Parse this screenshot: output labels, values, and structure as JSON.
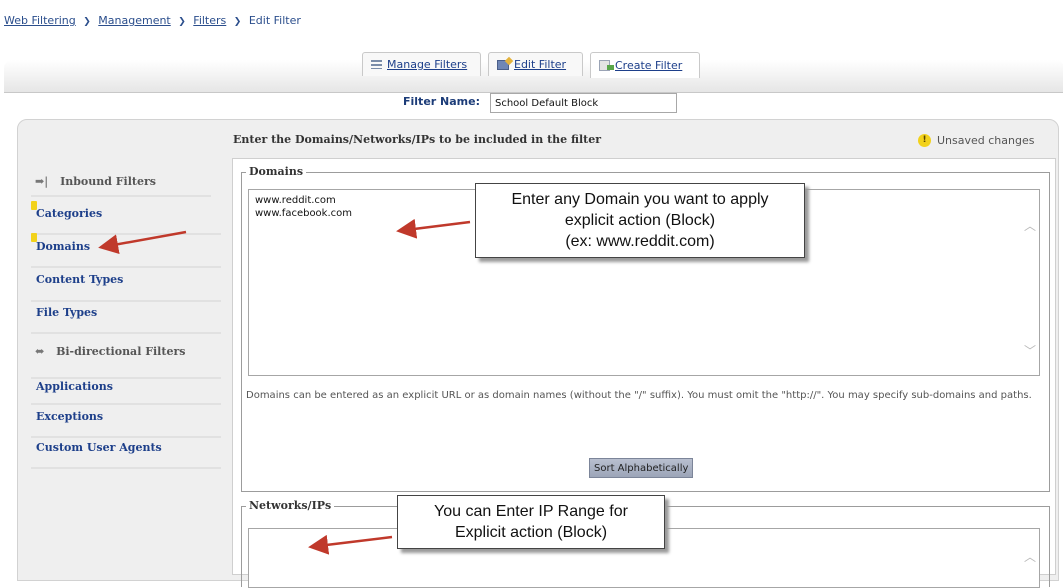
{
  "breadcrumb": {
    "items": [
      "Web Filtering",
      "Management",
      "Filters"
    ],
    "current": "Edit Filter",
    "separator": "❯"
  },
  "tabs": [
    {
      "label": "Manage Filters",
      "icon": "list-icon"
    },
    {
      "label": "Edit Filter",
      "icon": "edit-icon"
    },
    {
      "label": "Create Filter",
      "icon": "create-icon"
    }
  ],
  "filter_name": {
    "label": "Filter Name:",
    "value": "School Default Block"
  },
  "panel": {
    "instructions": "Enter the Domains/Networks/IPs to be included in the filter",
    "status": "Unsaved changes"
  },
  "sidebar": {
    "inbound_header": "Inbound Filters",
    "inbound_items": [
      "Categories",
      "Domains",
      "Content Types",
      "File Types"
    ],
    "bidirectional_header": "Bi-directional Filters",
    "bidirectional_items": [
      "Applications",
      "Exceptions",
      "Custom User Agents"
    ]
  },
  "domains": {
    "legend": "Domains",
    "entries": [
      "www.reddit.com",
      "www.facebook.com"
    ],
    "help": "Domains can be entered as an explicit URL or as domain names (without the \"/\" suffix). You must omit the \"http://\". You may specify sub-domains and paths.",
    "sort_button": "Sort Alphabetically"
  },
  "networks": {
    "legend": "Networks/IPs"
  },
  "callouts": {
    "domains": [
      "Enter any Domain you want to apply",
      "explicit action (Block)",
      "(ex: www.reddit.com)"
    ],
    "networks": [
      "You can Enter IP Range for",
      "Explicit action (Block)"
    ]
  },
  "colors": {
    "link": "#1d3f8a",
    "warning": "#f2d21b",
    "annotation_arrow": "#c0392b"
  }
}
